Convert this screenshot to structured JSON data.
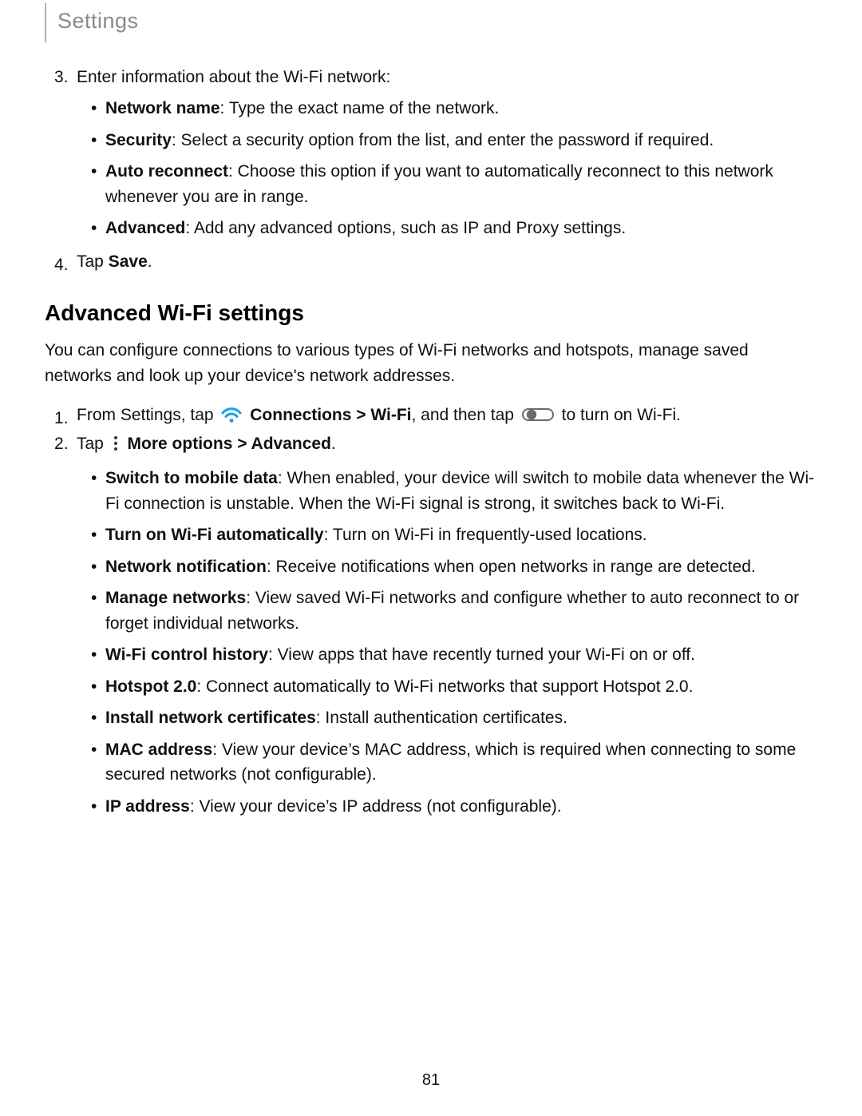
{
  "header": {
    "title": "Settings"
  },
  "page_number": "81",
  "steps_a": {
    "start": 3,
    "items": [
      {
        "text": "Enter information about the Wi-Fi network:",
        "bullets": [
          {
            "bold": "Network name",
            "rest": ": Type the exact name of the network."
          },
          {
            "bold": "Security",
            "rest": ": Select a security option from the list, and enter the password if required."
          },
          {
            "bold": "Auto reconnect",
            "rest": ": Choose this option if you want to automatically reconnect to this network whenever you are in range."
          },
          {
            "bold": "Advanced",
            "rest": ": Add any advanced options, such as IP and Proxy settings."
          }
        ]
      },
      {
        "pre": "Tap ",
        "bold": "Save",
        "post": "."
      }
    ]
  },
  "section": {
    "heading": "Advanced Wi-Fi settings",
    "intro": "You can configure connections to various types of Wi-Fi networks and hotspots, manage saved networks and look up your device's network addresses."
  },
  "steps_b": {
    "start": 1,
    "item1": {
      "t1": "From Settings, tap ",
      "t2_bold": "Connections",
      "t3_bold": " > Wi-Fi",
      "t4": ", and then tap ",
      "t5": " to turn on Wi-Fi."
    },
    "item2": {
      "t1": "Tap ",
      "t2_bold": "More options",
      "t3_bold": " > Advanced",
      "t4": ".",
      "bullets": [
        {
          "bold": "Switch to mobile data",
          "rest": ": When enabled, your device will switch to mobile data whenever the Wi-Fi connection is unstable. When the Wi-Fi signal is strong, it switches back to Wi-Fi."
        },
        {
          "bold": "Turn on Wi-Fi automatically",
          "rest": ": Turn on Wi-Fi in frequently-used locations."
        },
        {
          "bold": "Network notification",
          "rest": ": Receive notifications when open networks in range are detected."
        },
        {
          "bold": "Manage networks",
          "rest": ": View saved Wi-Fi networks and configure whether to auto reconnect to or forget individual networks."
        },
        {
          "bold": "Wi-Fi control history",
          "rest": ": View apps that have recently turned your Wi-Fi on or off."
        },
        {
          "bold": "Hotspot 2.0",
          "rest": ": Connect automatically to Wi-Fi networks that support Hotspot 2.0."
        },
        {
          "bold": "Install network certificates",
          "rest": ": Install authentication certificates."
        },
        {
          "bold": "MAC address",
          "rest": ": View your device’s MAC address, which is required when connecting to some secured networks (not configurable)."
        },
        {
          "bold": "IP address",
          "rest": ": View your device’s IP address (not configurable)."
        }
      ]
    }
  }
}
